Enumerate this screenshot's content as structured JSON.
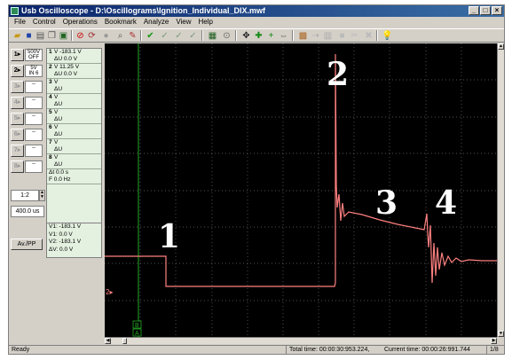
{
  "window": {
    "title": "Usb Oscilloscope - D:\\Oscillograms\\Ignition_Individual_DIX.mwf",
    "controls": [
      "_",
      "□",
      "×"
    ]
  },
  "menu": [
    "File",
    "Control",
    "Operations",
    "Bookmark",
    "Analyze",
    "View",
    "Help"
  ],
  "toolbar_icons": [
    "open-icon",
    "save-icon",
    "print-icon",
    "copy-icon",
    "export-icon",
    "stop-icon",
    "refresh-icon",
    "record-icon",
    "zoom-icon",
    "marker-icon",
    "check-icon",
    "check-alt-icon",
    "check-alt2-icon",
    "check-alt3-icon",
    "screen-icon",
    "zoom-fit-icon",
    "cursor-icon",
    "cross-icon",
    "plus-icon",
    "measure-icon",
    "settings-icon",
    "arrow-icon",
    "capture-icon",
    "disabled-icon",
    "disabled2-icon",
    "help-icon"
  ],
  "channels": [
    {
      "id": "1",
      "setting_top": "500V",
      "setting_bottom": "OFF"
    },
    {
      "id": "2",
      "setting_top": "5V",
      "setting_bottom": "IN 6"
    },
    {
      "id": "3",
      "setting_top": "--",
      "setting_bottom": ""
    },
    {
      "id": "4",
      "setting_top": "--",
      "setting_bottom": ""
    },
    {
      "id": "5",
      "setting_top": "--",
      "setting_bottom": ""
    },
    {
      "id": "6",
      "setting_top": "--",
      "setting_bottom": ""
    },
    {
      "id": "7",
      "setting_top": "--",
      "setting_bottom": ""
    },
    {
      "id": "8",
      "setting_top": "--",
      "setting_bottom": ""
    }
  ],
  "readouts": [
    {
      "n": "1",
      "v": "V -183.1 V",
      "dv": "ΔU    0.0 V"
    },
    {
      "n": "2",
      "v": "V  11.25 V",
      "dv": "ΔU    0.0 V"
    },
    {
      "n": "3",
      "v": "V",
      "dv": "ΔU"
    },
    {
      "n": "4",
      "v": "V",
      "dv": "ΔU"
    },
    {
      "n": "5",
      "v": "V",
      "dv": "ΔU"
    },
    {
      "n": "6",
      "v": "V",
      "dv": "ΔU"
    },
    {
      "n": "7",
      "v": "V",
      "dv": "ΔU"
    },
    {
      "n": "8",
      "v": "V",
      "dv": "ΔU"
    }
  ],
  "time_readout": {
    "dt": "Δt    0.0 s",
    "f": "F   0.0 Hz"
  },
  "zoom_ratio": "1:2",
  "timebase": "400.0 us",
  "cursors": {
    "line1": "V1: -183.1 V",
    "line2": "V1: 0.0 V",
    "line3": "V2: -183.1 V",
    "line4": "ΔV: 0.0 V"
  },
  "av_button": "Av./PP",
  "status": {
    "ready": "Ready",
    "total_time": "Total time: 00:00:30:953.224,",
    "current_time": "Current time: 00:00:26:991.744",
    "page": "1/8"
  },
  "annotations": [
    "1",
    "2",
    "3",
    "4"
  ],
  "markers": {
    "channel2": "2▸",
    "cursor_top": "B",
    "cursor_bottom": "A"
  },
  "colors": {
    "trace": "#ff8080",
    "cursor": "#22aa22",
    "grid": "#6e6e6e",
    "background": "#000000"
  }
}
